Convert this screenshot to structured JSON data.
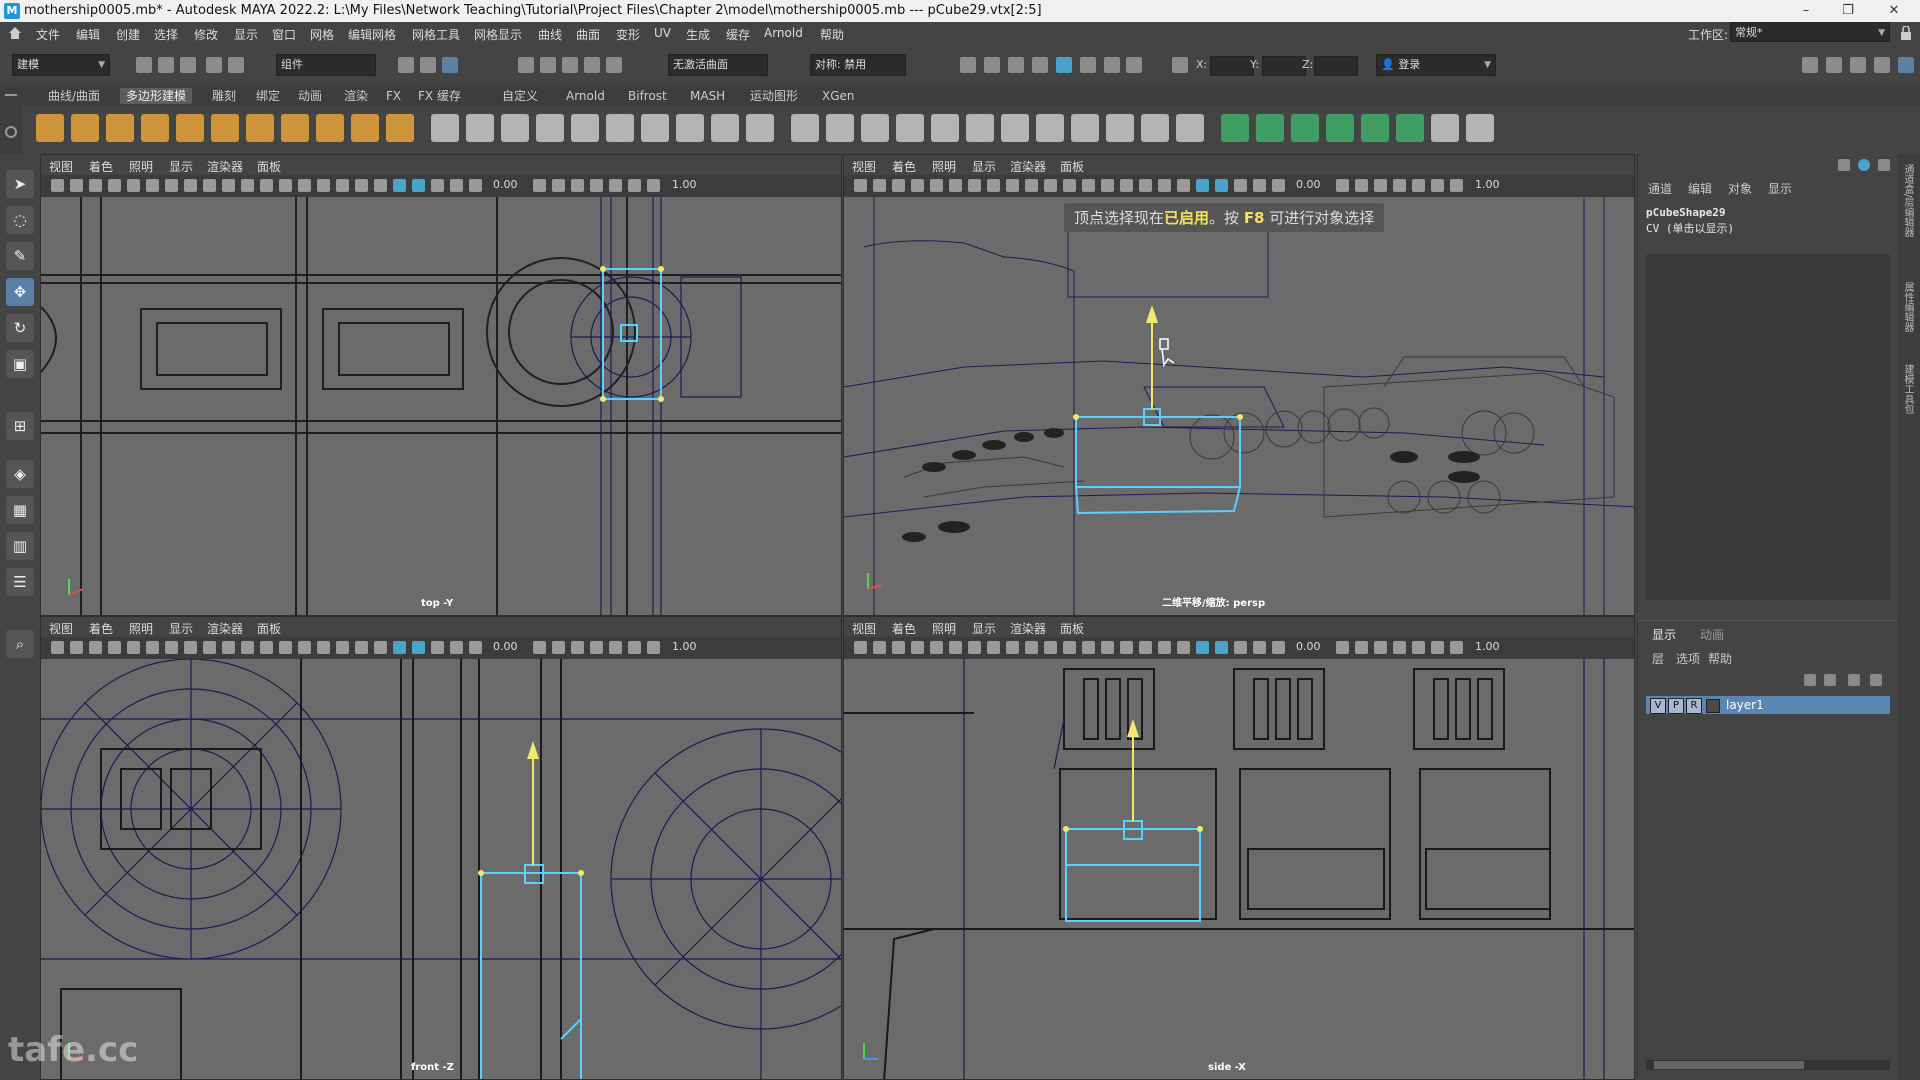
{
  "titlebar": {
    "app_icon": "M",
    "title": "mothership0005.mb* - Autodesk MAYA 2022.2: L:\\My Files\\Network Teaching\\Tutorial\\Project Files\\Chapter 2\\model\\mothership0005.mb  ---  pCube29.vtx[2:5]",
    "minimize": "–",
    "maximize": "❐",
    "close": "✕"
  },
  "menubar": {
    "items": [
      "文件",
      "编辑",
      "创建",
      "选择",
      "修改",
      "显示",
      "窗口",
      "网格",
      "编辑网格",
      "网格工具",
      "网格显示",
      "曲线",
      "曲面",
      "变形",
      "UV",
      "生成",
      "缓存",
      "Arnold",
      "帮助"
    ],
    "workspace_label": "工作区:",
    "workspace_value": "常规*"
  },
  "statusline": {
    "mode_menu": "建模",
    "component_field": "组件",
    "live_surface": "无激活曲面",
    "symmetry": "对称: 禁用",
    "x_label": "X:",
    "y_label": "Y:",
    "z_label": "Z:",
    "login": "登录"
  },
  "shelf": {
    "tabs": [
      "曲线/曲面",
      "多边形建模",
      "雕刻",
      "绑定",
      "动画",
      "渲染",
      "FX",
      "FX 缓存",
      "自定义",
      "Arnold",
      "Bifrost",
      "MASH",
      "运动图形",
      "XGen"
    ],
    "active_tab": "多边形建模",
    "icon_colors": [
      "#e8a33a",
      "#e8a33a",
      "#e8a33a",
      "#e8a33a",
      "#e8a33a",
      "#e8a33a",
      "#e8a33a",
      "#e8a33a",
      "#e8a33a",
      "#e8a33a",
      "#e8a33a",
      "#c8c8c8",
      "#c8c8c8",
      "#c8c8c8",
      "#c8c8c8",
      "#c8c8c8",
      "#c8c8c8",
      "#c8c8c8",
      "#c8c8c8",
      "#c8c8c8",
      "#c8c8c8",
      "#c8c8c8",
      "#c8c8c8",
      "#c8c8c8",
      "#c8c8c8",
      "#c8c8c8",
      "#c8c8c8",
      "#c8c8c8",
      "#c8c8c8",
      "#c8c8c8",
      "#c8c8c8",
      "#c8c8c8",
      "#c8c8c8",
      "#3fae6a",
      "#3fae6a",
      "#3fae6a",
      "#3fae6a",
      "#3fae6a",
      "#3fae6a",
      "#c8c8c8",
      "#c8c8c8"
    ]
  },
  "viewport_menu": [
    "视图",
    "着色",
    "照明",
    "显示",
    "渲染器",
    "面板"
  ],
  "viewport_toolbar_values": {
    "exposure": "0.00",
    "gamma": "1.00"
  },
  "viewports": {
    "top": {
      "label": "top -Y"
    },
    "persp": {
      "label": "二维平移/缩放: persp",
      "toast_prefix": "顶点选择现在",
      "toast_enabled": "已启用",
      "toast_mid": "。按 ",
      "toast_key": "F8",
      "toast_suffix": " 可进行对象选择"
    },
    "front": {
      "label": "front -Z"
    },
    "side": {
      "label": "side -X"
    }
  },
  "channelbox": {
    "tabs": [
      "通道",
      "编辑",
      "对象",
      "显示"
    ],
    "object_name": "pCubeShape29",
    "cv_text": "CV (单击以显示)"
  },
  "layereditor": {
    "tabs": [
      "显示",
      "动画"
    ],
    "menu": [
      "层",
      "选项",
      "帮助"
    ],
    "layer": {
      "v": "V",
      "p": "P",
      "r": "R",
      "name": "layer1"
    }
  },
  "sidestrip": {
    "labels": [
      "通道盒/层编辑器",
      "属性编辑器",
      "建模工具包"
    ]
  },
  "watermark": "tafe.cc",
  "colors": {
    "selection": "#5ad0ff",
    "manip_y": "#f2e86d",
    "wire": "#1b1b55",
    "layer_highlight": "#5a86b4"
  }
}
